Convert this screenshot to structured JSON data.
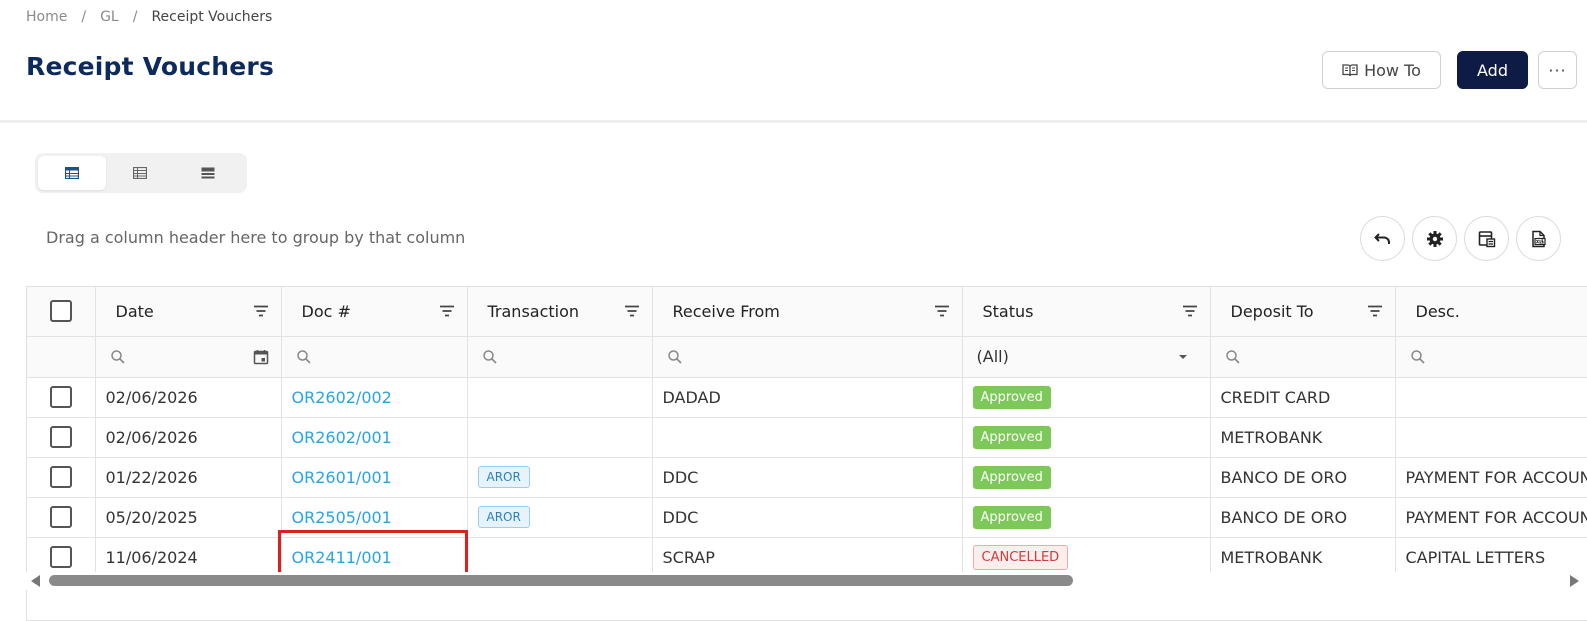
{
  "breadcrumb": {
    "home": "Home",
    "gl": "GL",
    "current": "Receipt Vouchers",
    "separator": "/"
  },
  "page_title": "Receipt Vouchers",
  "header_buttons": {
    "how_to": "How To",
    "add": "Add",
    "more": "···"
  },
  "group_hint": "Drag a column header here to group by that column",
  "view_modes": [
    "table-icon",
    "list-icon",
    "card-icon"
  ],
  "toolbar_icons": [
    "undo-icon",
    "gear-icon",
    "column-chooser-icon",
    "export-icon"
  ],
  "columns": [
    "Date",
    "Doc #",
    "Transaction",
    "Receive From",
    "Status",
    "Deposit To",
    "Desc."
  ],
  "status_filter": "(All)",
  "rows": [
    {
      "date": "02/06/2026",
      "doc": "OR2602/002",
      "transaction": "",
      "receive_from": "DADAD",
      "status": "Approved",
      "deposit_to": "CREDIT CARD",
      "desc": ""
    },
    {
      "date": "02/06/2026",
      "doc": "OR2602/001",
      "transaction": "",
      "receive_from": "",
      "status": "Approved",
      "deposit_to": "METROBANK",
      "desc": ""
    },
    {
      "date": "01/22/2026",
      "doc": "OR2601/001",
      "transaction": "AROR",
      "receive_from": "DDC",
      "status": "Approved",
      "deposit_to": "BANCO DE ORO",
      "desc": "PAYMENT FOR ACCOUNT"
    },
    {
      "date": "05/20/2025",
      "doc": "OR2505/001",
      "transaction": "AROR",
      "receive_from": "DDC",
      "status": "Approved",
      "deposit_to": "BANCO DE ORO",
      "desc": "PAYMENT FOR ACCOUNT"
    },
    {
      "date": "11/06/2024",
      "doc": "OR2411/001",
      "transaction": "",
      "receive_from": "SCRAP",
      "status": "CANCELLED",
      "deposit_to": "METROBANK",
      "desc": "CAPITAL LETTERS"
    }
  ],
  "colors": {
    "title": "#0d2a5c",
    "add_button": "#0d1b45",
    "link": "#29a4e3",
    "approved": "#7cc95a",
    "cancelled": "#d33a3a",
    "highlight": "#e01e1e"
  }
}
